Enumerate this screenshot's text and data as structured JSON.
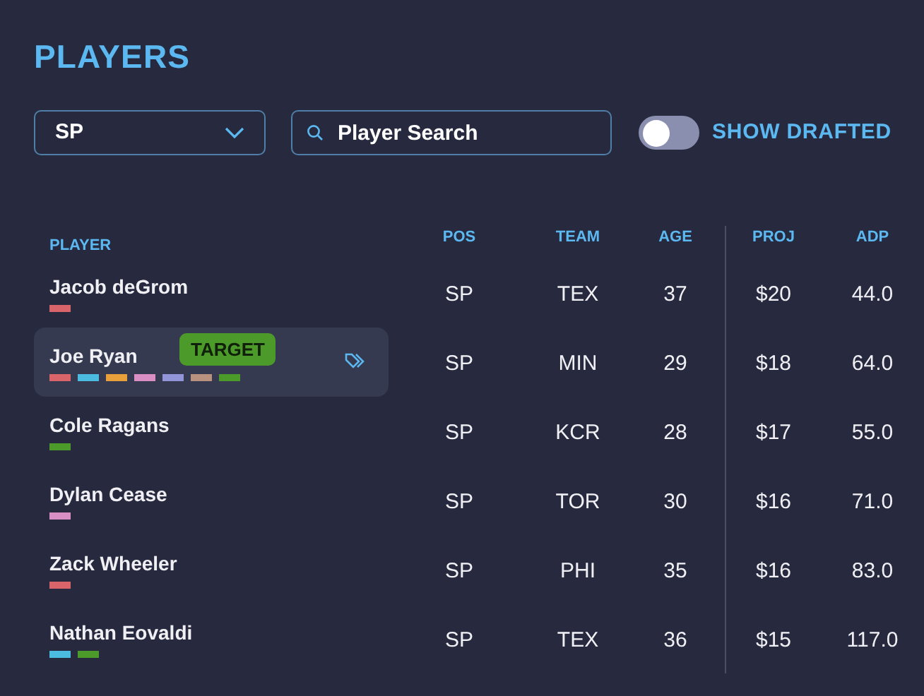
{
  "title": "PLAYERS",
  "position_select": {
    "value": "SP"
  },
  "search": {
    "placeholder": "Player Search"
  },
  "show_drafted": {
    "label": "SHOW DRAFTED",
    "on": false
  },
  "table": {
    "columns": [
      "PLAYER",
      "POS",
      "TEAM",
      "AGE",
      "PROJ",
      "ADP"
    ],
    "rows": [
      {
        "name": "Jacob deGrom",
        "pos": "SP",
        "team": "TEX",
        "age": "37",
        "proj": "$20",
        "adp": "44.0",
        "selected": false,
        "tags": [
          {
            "color": "#d9646a"
          }
        ]
      },
      {
        "name": "Joe Ryan",
        "pos": "SP",
        "team": "MIN",
        "age": "29",
        "proj": "$18",
        "adp": "64.0",
        "selected": true,
        "badge": "TARGET",
        "tags": [
          {
            "color": "#d9646a"
          },
          {
            "color": "#4bbbe0"
          },
          {
            "color": "#e8a13a"
          },
          {
            "color": "#d98fc4"
          },
          {
            "color": "#9296d8"
          },
          {
            "color": "#b8917f"
          },
          {
            "color": "#4b9a2a"
          }
        ]
      },
      {
        "name": "Cole Ragans",
        "pos": "SP",
        "team": "KCR",
        "age": "28",
        "proj": "$17",
        "adp": "55.0",
        "selected": false,
        "tags": [
          {
            "color": "#4b9a2a"
          }
        ]
      },
      {
        "name": "Dylan Cease",
        "pos": "SP",
        "team": "TOR",
        "age": "30",
        "proj": "$16",
        "adp": "71.0",
        "selected": false,
        "tags": [
          {
            "color": "#d98fc4"
          }
        ]
      },
      {
        "name": "Zack Wheeler",
        "pos": "SP",
        "team": "PHI",
        "age": "35",
        "proj": "$16",
        "adp": "83.0",
        "selected": false,
        "tags": [
          {
            "color": "#d9646a"
          }
        ]
      },
      {
        "name": "Nathan Eovaldi",
        "pos": "SP",
        "team": "TEX",
        "age": "36",
        "proj": "$15",
        "adp": "117.0",
        "selected": false,
        "tags": [
          {
            "color": "#4bbbe0"
          },
          {
            "color": "#4b9a2a"
          }
        ]
      }
    ]
  }
}
